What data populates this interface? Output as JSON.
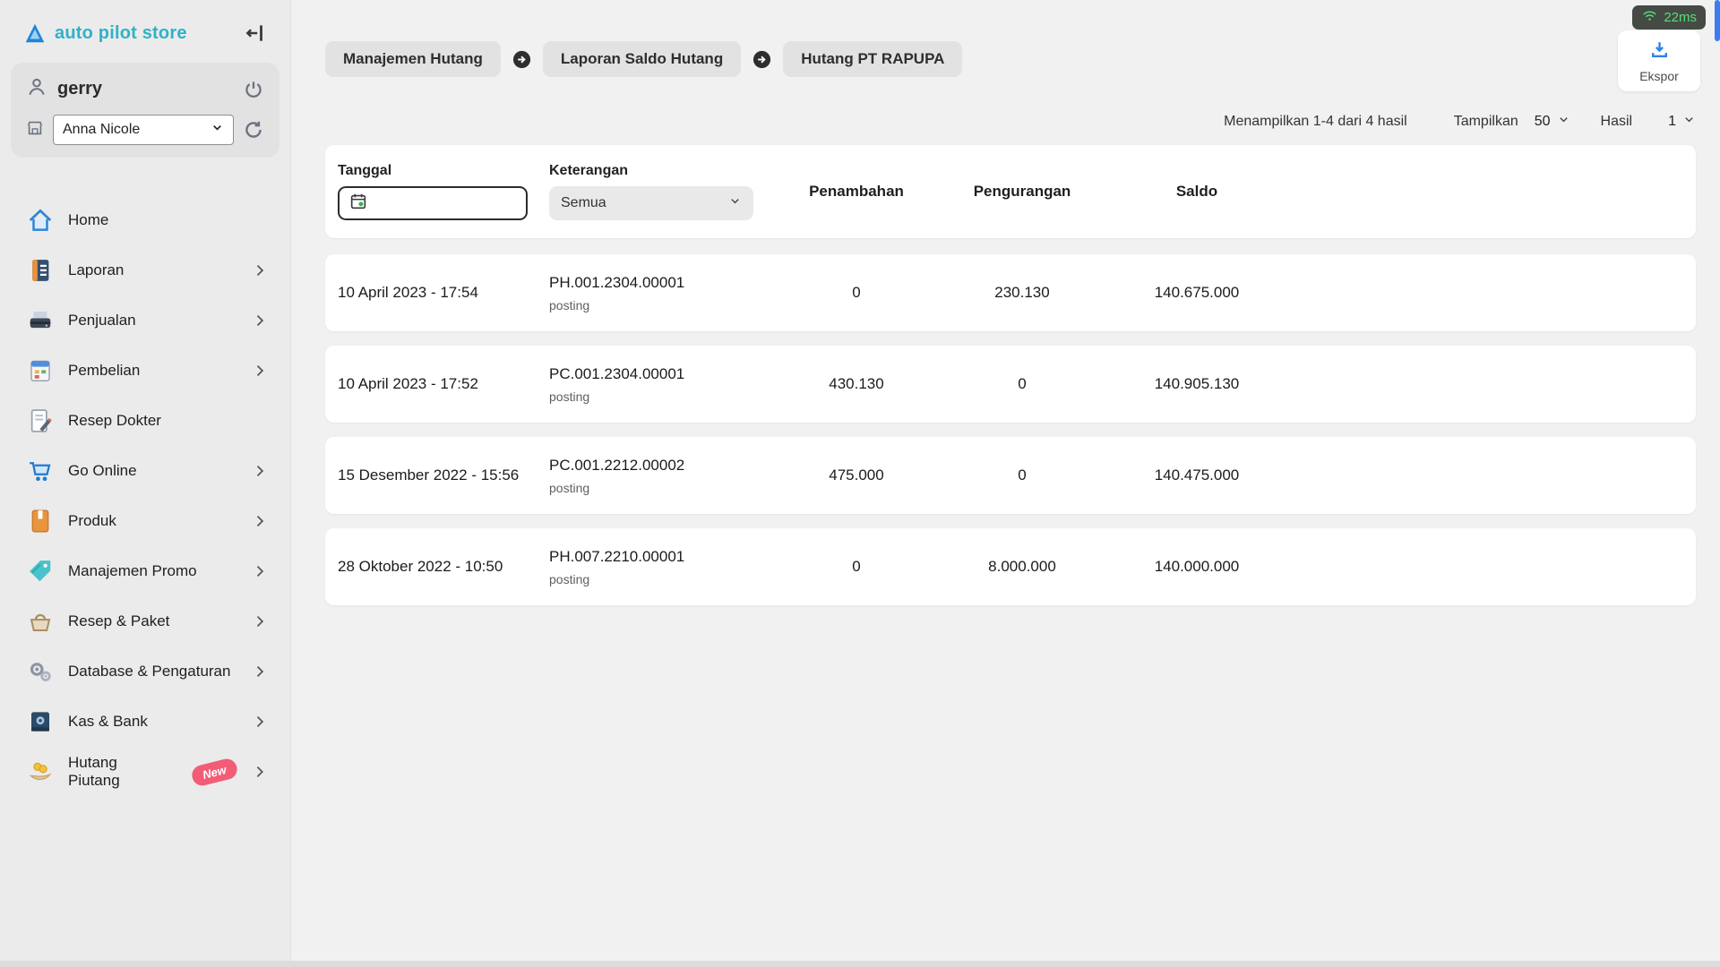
{
  "app": {
    "latency": "22ms"
  },
  "sidebar": {
    "logo_text": "auto pilot store",
    "user_name": "gerry",
    "outlet_value": "Anna Nicole",
    "items": [
      {
        "label": "Home",
        "icon": "home-icon",
        "chevron": false
      },
      {
        "label": "Laporan",
        "icon": "report-icon",
        "chevron": true
      },
      {
        "label": "Penjualan",
        "icon": "sales-icon",
        "chevron": true
      },
      {
        "label": "Pembelian",
        "icon": "purchase-icon",
        "chevron": true
      },
      {
        "label": "Resep Dokter",
        "icon": "prescription-icon",
        "chevron": false
      },
      {
        "label": "Go Online",
        "icon": "cart-icon",
        "chevron": true
      },
      {
        "label": "Produk",
        "icon": "product-icon",
        "chevron": true
      },
      {
        "label": "Manajemen Promo",
        "icon": "promo-icon",
        "chevron": true
      },
      {
        "label": "Resep & Paket",
        "icon": "basket-icon",
        "chevron": true
      },
      {
        "label": "Database & Pengaturan",
        "icon": "settings-icon",
        "chevron": true
      },
      {
        "label": "Kas & Bank",
        "icon": "bank-icon",
        "chevron": true
      },
      {
        "label": "Hutang Piutang",
        "icon": "debt-icon",
        "chevron": true,
        "badge": "New"
      }
    ]
  },
  "breadcrumb": [
    "Manajemen Hutang",
    "Laporan Saldo Hutang",
    "Hutang PT RAPUPA"
  ],
  "toolbar": {
    "export_label": "Ekspor"
  },
  "results": {
    "summary": "Menampilkan 1-4 dari 4 hasil",
    "show_label": "Tampilkan",
    "show_value": "50",
    "result_label": "Hasil",
    "result_value": "1"
  },
  "table": {
    "filters": {
      "tanggal_label": "Tanggal",
      "date_value": "",
      "keterangan_label": "Keterangan",
      "keterangan_value": "Semua"
    },
    "columns": [
      "Penambahan",
      "Pengurangan",
      "Saldo"
    ],
    "rows": [
      {
        "tanggal": "10 April 2023 - 17:54",
        "kode": "PH.001.2304.00001",
        "status": "posting",
        "penambahan": "0",
        "pengurangan": "230.130",
        "saldo": "140.675.000"
      },
      {
        "tanggal": "10 April 2023 - 17:52",
        "kode": "PC.001.2304.00001",
        "status": "posting",
        "penambahan": "430.130",
        "pengurangan": "0",
        "saldo": "140.905.130"
      },
      {
        "tanggal": "15 Desember 2022 - 15:56",
        "kode": "PC.001.2212.00002",
        "status": "posting",
        "penambahan": "475.000",
        "pengurangan": "0",
        "saldo": "140.475.000"
      },
      {
        "tanggal": "28 Oktober 2022 - 10:50",
        "kode": "PH.007.2210.00001",
        "status": "posting",
        "penambahan": "0",
        "pengurangan": "8.000.000",
        "saldo": "140.000.000"
      }
    ]
  },
  "colors": {
    "accent_teal": "#2cb3c9",
    "latency_green": "#58dd79",
    "badge_red": "#f25c77",
    "export_blue": "#2f80ed",
    "scroll_blue": "#3b7df0"
  }
}
